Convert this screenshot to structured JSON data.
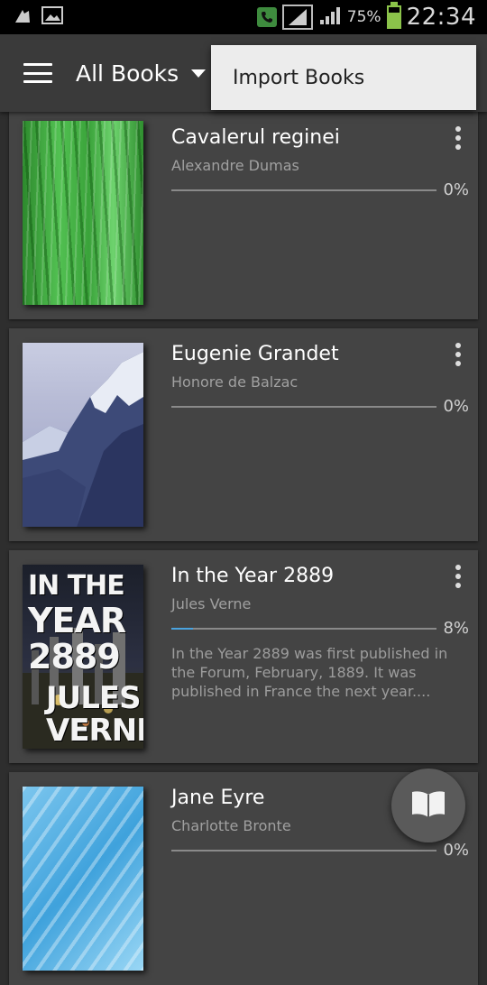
{
  "status_bar": {
    "battery_percent": "75%",
    "battery_level": 0.75,
    "time": "22:34",
    "icons": [
      "usb-debug-icon",
      "image-icon",
      "call-icon",
      "sim-signal-icon",
      "signal-icon",
      "battery-icon"
    ]
  },
  "toolbar": {
    "title": "All Books",
    "menu_icon": "hamburger-menu-icon",
    "dropdown_icon": "dropdown-caret-icon"
  },
  "popup_menu": {
    "items": [
      {
        "label": "Import Books"
      }
    ]
  },
  "books": [
    {
      "title": "Cavalerul reginei",
      "author": "Alexandre Dumas",
      "progress_label": "0%",
      "progress": 0.0,
      "description": "",
      "cover": "green-texture-cover"
    },
    {
      "title": "Eugenie Grandet",
      "author": "Honore de Balzac",
      "progress_label": "0%",
      "progress": 0.0,
      "description": "",
      "cover": "mountain-cover"
    },
    {
      "title": "In the Year 2889",
      "author": "Jules Verne",
      "progress_label": "8%",
      "progress": 0.08,
      "description": "In the Year 2889 was first published in the Forum, February, 1889. It was published in France the next year....",
      "cover": "city-night-cover",
      "cover_text": [
        "IN THE",
        "YEAR",
        "2889",
        "JULES",
        "VERNE"
      ]
    },
    {
      "title": "Jane Eyre",
      "author": "Charlotte Bronte",
      "progress_label": "0%",
      "progress": 0.0,
      "description": "",
      "cover": "blue-streak-cover"
    }
  ],
  "fab": {
    "icon": "open-book-icon"
  },
  "colors": {
    "background": "#2e2e2e",
    "card": "#444444",
    "toolbar": "#3a3a3a",
    "progress_fill": "#4aa3df",
    "popup": "#ececec"
  }
}
